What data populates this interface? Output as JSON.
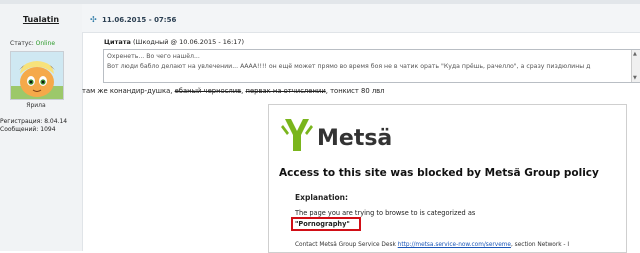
{
  "user": {
    "name": "Tualatin",
    "status_label": "Статус:",
    "status_value": "Online",
    "rank": "Ярила",
    "reg_label": "Регистрация:",
    "reg_value": "8.04.14",
    "posts_label": "Сообщений:",
    "posts_value": "1094"
  },
  "post": {
    "date": "11.06.2015 - 07:56",
    "quote_label": "Цитата",
    "quote_meta": "(Шкодный @ 10.06.2015 - 16:17)",
    "quote_line1": "Охренеть... Во чего нашёл...",
    "quote_line2": "Вот люди бабло делают на увлечении... АААА!!!! он ещё может прямо во время боя не в чатик орать \"Куда прёшь, рачелло\", а сразу пиздюлины д",
    "text_before": "там же конандир-душка, ",
    "text_strike1": "ебаный чернослив",
    "text_sep": ", ",
    "text_strike2": "первак на отчислении",
    "text_after": ", тонкист 80 лвл"
  },
  "blocked_page": {
    "brand": "Metsä",
    "heading": "Access to this site was blocked by Metsä Group policy",
    "explanation_label": "Explanation:",
    "category_text": "The page you are trying to browse to is categorized as",
    "category_value": "\"Pornography\"",
    "contact_text": "Contact Metsä Group Service Desk ",
    "contact_link": "http://metsa.service-now.com/serveme",
    "contact_after": ", section Network - I"
  },
  "colors": {
    "online": "#2a9a28",
    "brand_green": "#7ab51d",
    "highlight_red": "#d10e16"
  }
}
